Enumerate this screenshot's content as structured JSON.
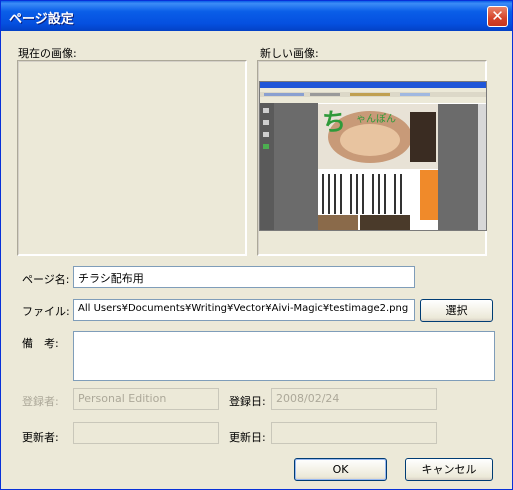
{
  "window": {
    "title": "ページ設定",
    "close_glyph": "✕"
  },
  "current_image": {
    "label": "現在の画像:"
  },
  "new_image": {
    "label": "新しい画像:"
  },
  "page_name": {
    "label": "ページ名:",
    "value": "チラシ配布用"
  },
  "file": {
    "label": "ファイル:",
    "value": "All Users¥Documents¥Writing¥Vector¥Aivi-Magic¥testimage2.png",
    "select_button": "選択"
  },
  "notes": {
    "label": "備　考:",
    "value": ""
  },
  "registrant": {
    "label": "登録者:",
    "value": "Personal Edition"
  },
  "registered_date": {
    "label": "登録日:",
    "value": "2008/02/24"
  },
  "updater": {
    "label": "更新者:",
    "value": ""
  },
  "updated_date": {
    "label": "更新日:",
    "value": ""
  },
  "buttons": {
    "ok": "OK",
    "cancel": "キャンセル"
  }
}
